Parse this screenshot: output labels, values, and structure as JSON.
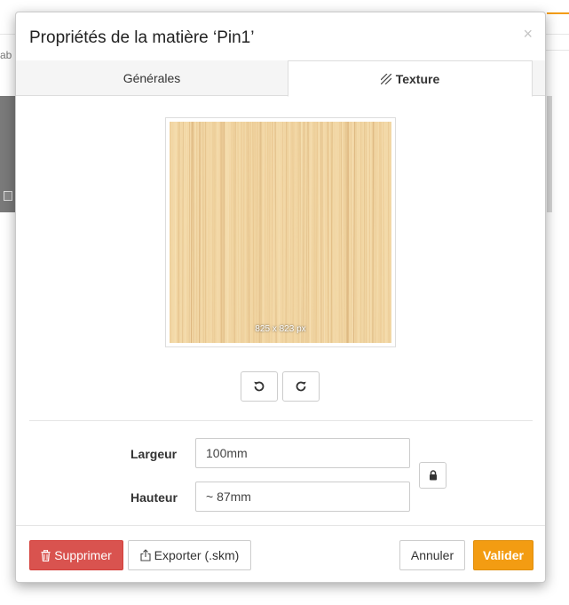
{
  "background": {
    "partial_text": "ab"
  },
  "dialog": {
    "title": "Propriétés de la matière ‘Pin1’",
    "close_symbol": "×"
  },
  "tabs": [
    {
      "label": "Générales",
      "active": false
    },
    {
      "label": "Texture",
      "active": true,
      "icon": "hatch-icon"
    }
  ],
  "texture": {
    "image_size_label": "825 x 823 px",
    "rotate_left_icon": "rotate-ccw-icon",
    "rotate_right_icon": "rotate-cw-icon"
  },
  "dimensions": {
    "width_label": "Largeur",
    "width_value": "100mm",
    "height_label": "Hauteur",
    "height_value": "~ 87mm",
    "lock_icon": "lock-icon"
  },
  "footer": {
    "delete_label": "Supprimer",
    "export_label": "Exporter (.skm)",
    "cancel_label": "Annuler",
    "validate_label": "Valider"
  },
  "colors": {
    "accent_orange": "#f39c12",
    "danger_red": "#d9534f",
    "wood_base": "#f1d5a2"
  }
}
